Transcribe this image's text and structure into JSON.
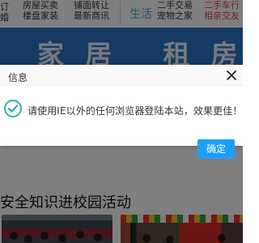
{
  "site": {
    "nav": {
      "items": [
        "房屋买卖",
        "楼盘家装",
        "铺面转让",
        "最新商讯",
        "生活",
        "二手交易",
        "宠物之家",
        "二手车行",
        "相亲交友"
      ],
      "left_partial": [
        "订",
        "婚"
      ]
    },
    "banner": {
      "text": "家居 租房"
    },
    "section": {
      "title": "安全知识进校园活动"
    }
  },
  "dialog": {
    "title": "信息",
    "message": "请使用IE以外的任何浏览器登陆本站，效果更佳！",
    "confirm_label": "确定"
  },
  "colors": {
    "overlay": "#000000",
    "dialog_header": "#f8f8f8",
    "success_icon": "#26b5a2",
    "confirm_button": "#1e9fff",
    "nav_life": "#29a8e0",
    "nav_red": "#e33b3b",
    "banner": "#2b74c7"
  },
  "icons": {
    "success": "check-circle-icon",
    "close": "close-icon"
  }
}
